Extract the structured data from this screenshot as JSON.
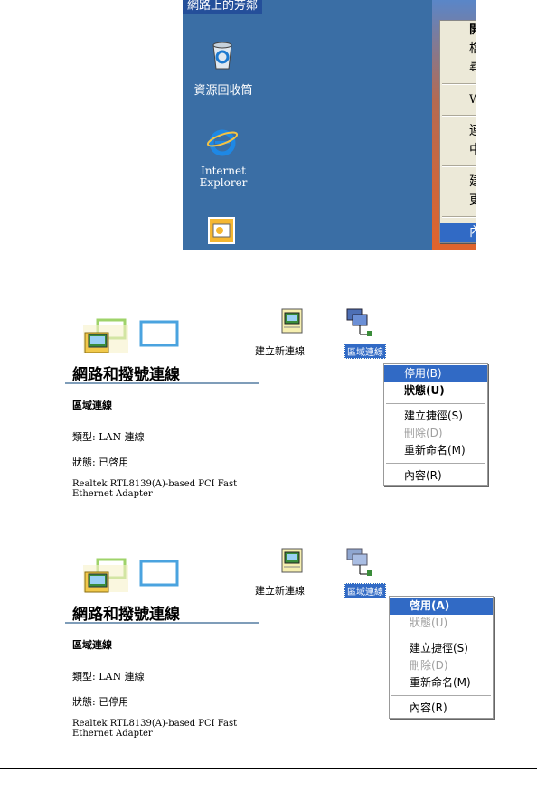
{
  "desktop": {
    "network_places_label": "網路上的芳鄰",
    "recycle_bin_label": "資源回收筒",
    "ie_label_line1": "Internet",
    "ie_label_line2": "Explorer",
    "context_menu": {
      "open": "開啓(O)",
      "explorer": "檔案總管(X)",
      "search_computer": "尋找電腦(C)...",
      "who_am_i": "Who Am I (W)...",
      "map_drive": "連線網路磁碟機(N)...",
      "disconnect_drive": "中斷網路磁碟機(I)...",
      "create_shortcut": "建立捷徑(S)",
      "rename": "更名(M)",
      "properties": "內容(R)"
    }
  },
  "panels": [
    {
      "title": "網路和撥號連線",
      "section_title": "區域連線",
      "type_text": "類型: LAN 連線",
      "status_text": "狀態: 已啓用",
      "adapter_text": "Realtek RTL8139(A)-based PCI Fast Ethernet Adapter",
      "new_connection_label": "建立新連線",
      "lan_label": "區域連線",
      "menu": {
        "first": "停用(B)",
        "second": "狀態(U)",
        "create_shortcut": "建立捷徑(S)",
        "delete": "刪除(D)",
        "rename": "重新命名(M)",
        "properties": "內容(R)"
      }
    },
    {
      "title": "網路和撥號連線",
      "section_title": "區域連線",
      "type_text": "類型: LAN 連線",
      "status_text": "狀態: 已停用",
      "adapter_text": "Realtek RTL8139(A)-based PCI Fast Ethernet Adapter",
      "new_connection_label": "建立新連線",
      "lan_label": "區域連線",
      "menu": {
        "first": "啓用(A)",
        "second": "狀態(U)",
        "create_shortcut": "建立捷徑(S)",
        "delete": "刪除(D)",
        "rename": "重新命名(M)",
        "properties": "內容(R)"
      }
    }
  ],
  "colors": {
    "desktop_blue": "#3a6ea5",
    "highlight": "#316ac5",
    "menu_bg": "#ece9d8"
  }
}
